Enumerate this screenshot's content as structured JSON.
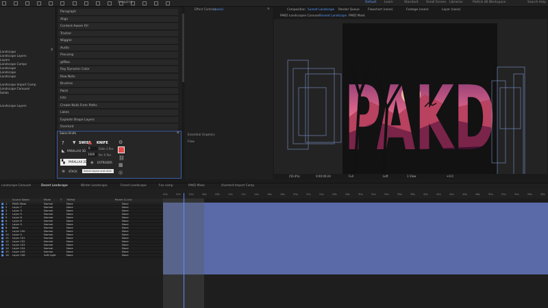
{
  "workspaces": {
    "default": "Default",
    "learn": "Learn",
    "standard": "Standard",
    "small_screen": "Small Screen",
    "libraries": "Libraries",
    "workspace": "Pettick 4K Workspace",
    "search": "Search Help"
  },
  "toolbar": {
    "snapping": "Snapping"
  },
  "project": {
    "items": [
      "Landscape",
      "Landscape Layers",
      "Layers",
      "Landscape Comps",
      "Landscape",
      "Landscape",
      "Landscape",
      "Landscape Import Comp",
      "Landscape Carousel",
      "Solids",
      "Landscape Layers"
    ]
  },
  "effects_list": [
    "Paragraph",
    "Align",
    "Content-Aware Fill",
    "Tracker",
    "Wiggler",
    "Audio",
    "Precomp",
    "gifBox",
    "Ray Dynamic Color",
    "Rew Note",
    "Brushes",
    "Paint",
    "Info",
    "Create Nulls From Paths",
    "Lakes",
    "Explode Shape Layers",
    "Overlord"
  ],
  "swiss": {
    "title": "Swiss Knife",
    "swiss_label": "SWISS",
    "knife_label": "KNIFE",
    "parallax": "PARALLAX 3D",
    "parallax2": "PARALLAX 2D",
    "depth": "0",
    "size": "1000",
    "slider1": "Slide 3 Pos",
    "slider2": "Per X Pos",
    "extruder": "EXTRUDER",
    "tooltip": "Select layers and click!",
    "stack": "STACK"
  },
  "effect_controls": {
    "tab": "Effect Controls",
    "tab_target": "(none)",
    "essential": "Essential Graphics",
    "flow": "Flow"
  },
  "composition": {
    "tab": "Composition",
    "comp_name": "Sunset Landscape",
    "render_queue": "Render Queue",
    "flowchart": "Flowchart (none)",
    "footage": "Footage (none)",
    "layer": "Layer (none)",
    "breadcrumb1": "PAKD Landscapes Carousel",
    "breadcrumb2": "Sunset Landscape",
    "breadcrumb3": "PAKD Mask",
    "art_text": "PAKD",
    "zoom": "(50.4%)",
    "timecode": "0:00:00:24",
    "resolution": "Full",
    "camera": "Left",
    "view": "1 View",
    "plus": "+0.0"
  },
  "timeline_tabs": [
    "Landscape Carousel",
    "Desert Landscape",
    "Winter Landscape",
    "Forest Landscape",
    "Fox comp",
    "PAKD Mask",
    "Overlord Import Comp"
  ],
  "timeline_ticks": [
    "00s",
    "02s",
    "04s",
    "06s",
    "08s",
    "10s",
    "12s",
    "14s",
    "16s",
    "18s",
    "20s",
    "22s",
    "24s",
    "26s",
    "28s",
    "30s",
    "32s",
    "34s",
    "36s",
    "38s",
    "40s",
    "42s",
    "44s",
    "46s",
    "48s",
    "50s",
    "52s",
    "54s",
    "56s",
    "58s"
  ],
  "columns": {
    "source": "Source Name",
    "mode": "Mode",
    "t": "T",
    "trkmat": "TrkMat",
    "parent": "Parent & Link"
  },
  "layers": [
    {
      "num": "1",
      "name": "PAKD Mask",
      "mode": "Normal",
      "trk": "None",
      "parent": "None"
    },
    {
      "num": "2",
      "name": "Layer 7",
      "mode": "Normal",
      "trk": "None",
      "parent": "None"
    },
    {
      "num": "3",
      "name": "Layer 3",
      "mode": "Normal",
      "trk": "None",
      "parent": "None"
    },
    {
      "num": "4",
      "name": "Layer 9",
      "mode": "Normal",
      "trk": "None",
      "parent": "None"
    },
    {
      "num": "5",
      "name": "Layer 6",
      "mode": "Normal",
      "trk": "None",
      "parent": "None"
    },
    {
      "num": "6",
      "name": "Layer 8",
      "mode": "Normal",
      "trk": "None",
      "parent": "None"
    },
    {
      "num": "7",
      "name": "Layer 9",
      "mode": "Normal",
      "trk": "None",
      "parent": "None"
    },
    {
      "num": "8",
      "name": "Base",
      "mode": "Normal",
      "trk": "None",
      "parent": "None"
    },
    {
      "num": "9",
      "name": "Layer 100",
      "mode": "Normal",
      "trk": "None",
      "parent": "None"
    },
    {
      "num": "10",
      "name": "Layer 0",
      "mode": "Normal",
      "trk": "None",
      "parent": "None"
    },
    {
      "num": "11",
      "name": "Layer 101",
      "mode": "Normal",
      "trk": "None",
      "parent": "None"
    },
    {
      "num": "12",
      "name": "Layer 102",
      "mode": "Normal",
      "trk": "None",
      "parent": "None"
    },
    {
      "num": "13",
      "name": "Layer 103",
      "mode": "Normal",
      "trk": "None",
      "parent": "None"
    },
    {
      "num": "14",
      "name": "Layer 104",
      "mode": "Normal",
      "trk": "None",
      "parent": "None"
    },
    {
      "num": "15",
      "name": "Layer 105",
      "mode": "Normal",
      "trk": "None",
      "parent": "None"
    },
    {
      "num": "16",
      "name": "Layer 106",
      "mode": "Soft Light",
      "trk": "None",
      "parent": "None"
    }
  ],
  "colors": {
    "accent": "#5a9dff",
    "track": "#5a6aa8",
    "swiss_border": "#3a5fa8",
    "tooltip_bg": "#efefef",
    "knife_red": "#e24a4a"
  }
}
